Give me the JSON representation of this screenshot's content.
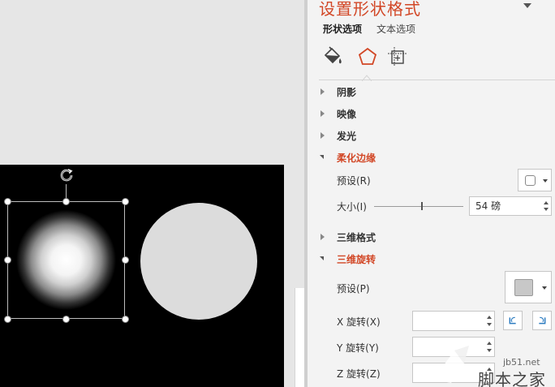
{
  "pane": {
    "title": "设置形状格式",
    "tabs": [
      {
        "label": "形状选项",
        "active": true
      },
      {
        "label": "文本选项",
        "active": false
      }
    ],
    "category_icons": [
      "fill-line-icon",
      "effects-pentagon-icon",
      "size-properties-icon"
    ],
    "sections": [
      {
        "label": "阴影",
        "expanded": false
      },
      {
        "label": "映像",
        "expanded": false
      },
      {
        "label": "发光",
        "expanded": false
      },
      {
        "label": "柔化边缘",
        "expanded": true
      },
      {
        "label": "三维格式",
        "expanded": false
      },
      {
        "label": "三维旋转",
        "expanded": true
      }
    ],
    "soft_edges": {
      "preset_label": "预设(R)",
      "size_label": "大小(I)",
      "size_value": "54 磅"
    },
    "rotation_3d": {
      "preset_label": "预设(P)",
      "x_label": "X 旋转(X)",
      "y_label": "Y 旋转(Y)",
      "z_label": "Z 旋转(Z)",
      "x_value": "",
      "y_value": "",
      "z_value": ""
    },
    "accent_color": "#d24726"
  },
  "watermark": {
    "domain": "jb51.net",
    "text": "脚本之家"
  }
}
